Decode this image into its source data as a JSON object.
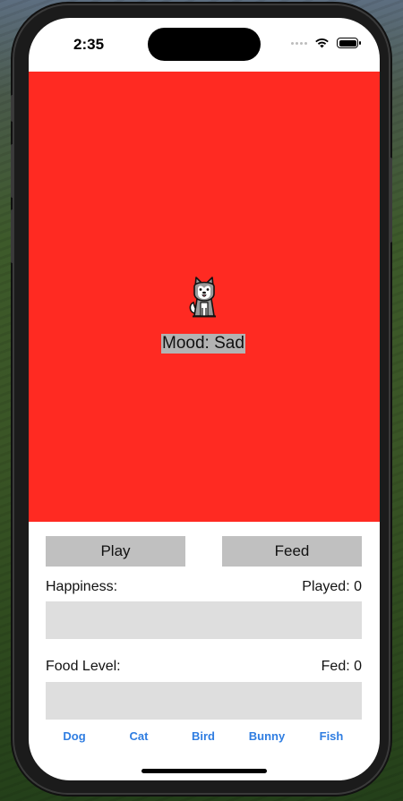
{
  "status_bar": {
    "time": "2:35"
  },
  "pet": {
    "background_color": "#ff2a22",
    "icon": "husky-dog-icon",
    "mood_label": "Mood: Sad"
  },
  "actions": {
    "play_label": "Play",
    "feed_label": "Feed"
  },
  "stats": {
    "happiness_label": "Happiness:",
    "played_label": "Played: 0",
    "happiness_level": 0,
    "food_label": "Food Level:",
    "fed_label": "Fed: 0",
    "food_level": 0
  },
  "tabs": [
    {
      "label": "Dog"
    },
    {
      "label": "Cat"
    },
    {
      "label": "Bird"
    },
    {
      "label": "Bunny"
    },
    {
      "label": "Fish"
    }
  ],
  "colors": {
    "accent": "#2f7de1",
    "button": "#c0c0c0",
    "bar_track": "#dedede"
  }
}
